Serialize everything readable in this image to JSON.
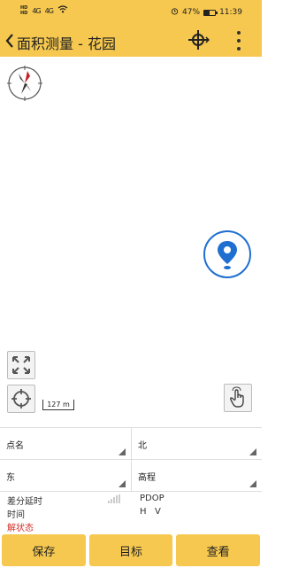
{
  "status_bar": {
    "sim1": "HD",
    "sim2": "HD",
    "signal1": "4G",
    "signal2": "4G",
    "battery_percent": "47%",
    "battery_level": 0.47,
    "time": "11:39"
  },
  "header": {
    "title": "面积测量 - 花园"
  },
  "map": {
    "scale_label": "127 m"
  },
  "fields": {
    "point_name_label": "点名",
    "north_label": "北",
    "east_label": "东",
    "elevation_label": "高程"
  },
  "info": {
    "diff_latency_label": "差分延时",
    "time_label": "时间",
    "fix_status_label": "解状态",
    "pdop_label": "PDOP",
    "h_label": "H",
    "v_label": "V"
  },
  "bottom": {
    "save_label": "保存",
    "target_label": "目标",
    "view_label": "查看"
  },
  "colors": {
    "accent": "#f6c84f",
    "locate": "#1f6fd0",
    "fix_status": "#d0302a"
  }
}
